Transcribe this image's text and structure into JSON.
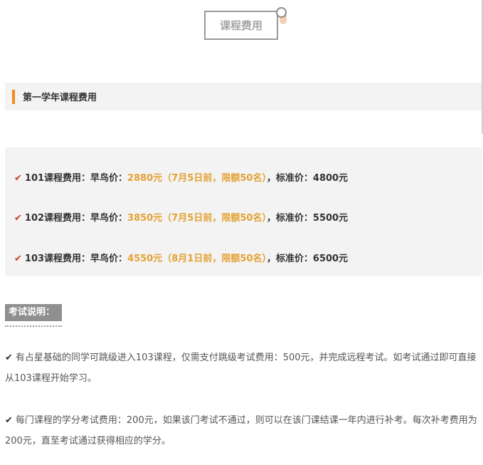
{
  "title": "课程费用",
  "section": {
    "title": "第一学年课程费用"
  },
  "fees": [
    {
      "label": "101课程费用：早鸟价：",
      "early": "2880元（7月5日前，限额50名）",
      "standard": "，标准价：4800元"
    },
    {
      "label": "102课程费用：早鸟价：",
      "early": "3850元（7月5日前，限额50名）",
      "standard": "，标准价：5500元"
    },
    {
      "label": "103课程费用：早鸟价：",
      "early": "4550元（8月1日前，限额50名）",
      "standard": "，标准价：6500元"
    }
  ],
  "exam": {
    "label": "考试说明：",
    "paragraphs": [
      "有占星基础的同学可跳级进入103课程，仅需支付跳级考试费用：500元，并完成远程考试。如考试通过即可直接从103课程开始学习。",
      "每门课程的学分考试费用：200元，如果该门考试不通过，则可以在该门课结课一年内进行补考。每次补考费用为200元，直至考试通过获得相应的学分。"
    ]
  },
  "icons": {
    "check": "✔"
  },
  "colors": {
    "accent": "#f28b1d",
    "price_highlight": "#e4a233",
    "check": "#d23c1a"
  }
}
